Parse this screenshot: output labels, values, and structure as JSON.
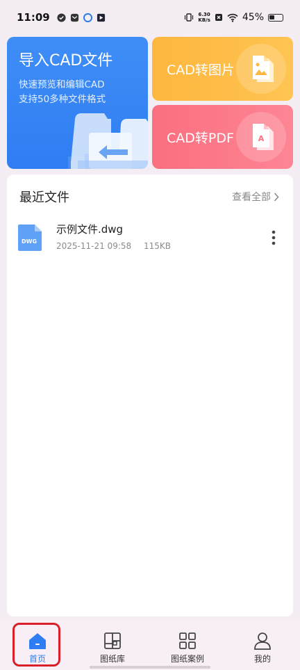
{
  "status_bar": {
    "time": "11:09",
    "net_speed_top": "6.30",
    "net_speed_unit": "KB/s",
    "battery": "45%"
  },
  "cards": {
    "import": {
      "title": "导入CAD文件",
      "subtitle_line1": "快速预览和编辑CAD",
      "subtitle_line2": "支持50多种文件格式"
    },
    "to_image": {
      "label": "CAD转图片"
    },
    "to_pdf": {
      "label": "CAD转PDF",
      "doc_letter": "A"
    }
  },
  "recent": {
    "title": "最近文件",
    "view_all": "查看全部",
    "files": [
      {
        "name": "示例文件.dwg",
        "date": "2025-11-21 09:58",
        "size": "115KB",
        "type": "DWG"
      }
    ]
  },
  "nav": {
    "items": [
      {
        "label": "首页",
        "icon": "home-icon",
        "active": true
      },
      {
        "label": "图纸库",
        "icon": "drawing-library-icon",
        "active": false
      },
      {
        "label": "图纸案例",
        "icon": "grid-icon",
        "active": false
      },
      {
        "label": "我的",
        "icon": "person-icon",
        "active": false
      }
    ]
  },
  "colors": {
    "primary": "#2f7df2",
    "image_card": "#fdb73e",
    "pdf_card": "#fb6f80",
    "highlight": "#d9202a"
  }
}
